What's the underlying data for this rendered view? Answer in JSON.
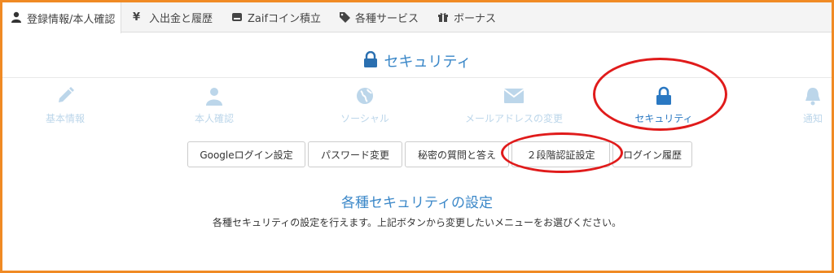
{
  "topnav": {
    "tabs": [
      {
        "label": "登録情報/本人確認",
        "icon": "user-icon",
        "active": true
      },
      {
        "label": "入出金と履歴",
        "icon": "yen-icon",
        "active": false
      },
      {
        "label": "Zaifコイン積立",
        "icon": "hdd-icon",
        "active": false
      },
      {
        "label": "各種サービス",
        "icon": "tag-icon",
        "active": false
      },
      {
        "label": "ボーナス",
        "icon": "gift-icon",
        "active": false
      }
    ]
  },
  "page": {
    "title": "セキュリティ",
    "title_icon": "lock-icon"
  },
  "categories": [
    {
      "label": "基本情報",
      "icon": "pencil-icon"
    },
    {
      "label": "本人確認",
      "icon": "user-icon"
    },
    {
      "label": "ソーシャル",
      "icon": "globe-icon"
    },
    {
      "label": "メールアドレスの変更",
      "icon": "envelope-icon"
    },
    {
      "label": "セキュリティ",
      "icon": "lock-icon",
      "active": true
    },
    {
      "label": "通知",
      "icon": "bell-icon"
    }
  ],
  "buttons": [
    {
      "label": "Googleログイン設定"
    },
    {
      "label": "パスワード変更"
    },
    {
      "label": "秘密の質問と答え"
    },
    {
      "label": "２段階認証設定"
    },
    {
      "label": "ログイン履歴"
    }
  ],
  "settings": {
    "heading": "各種セキュリティの設定",
    "description": "各種セキュリティの設定を行えます。上記ボタンから変更したいメニューをお選びください。"
  },
  "colors": {
    "accent_blue": "#3a87c8",
    "inactive_icon": "#bcd6ea",
    "frame_orange": "#f08a24",
    "annotation_red": "#e01b1b"
  }
}
